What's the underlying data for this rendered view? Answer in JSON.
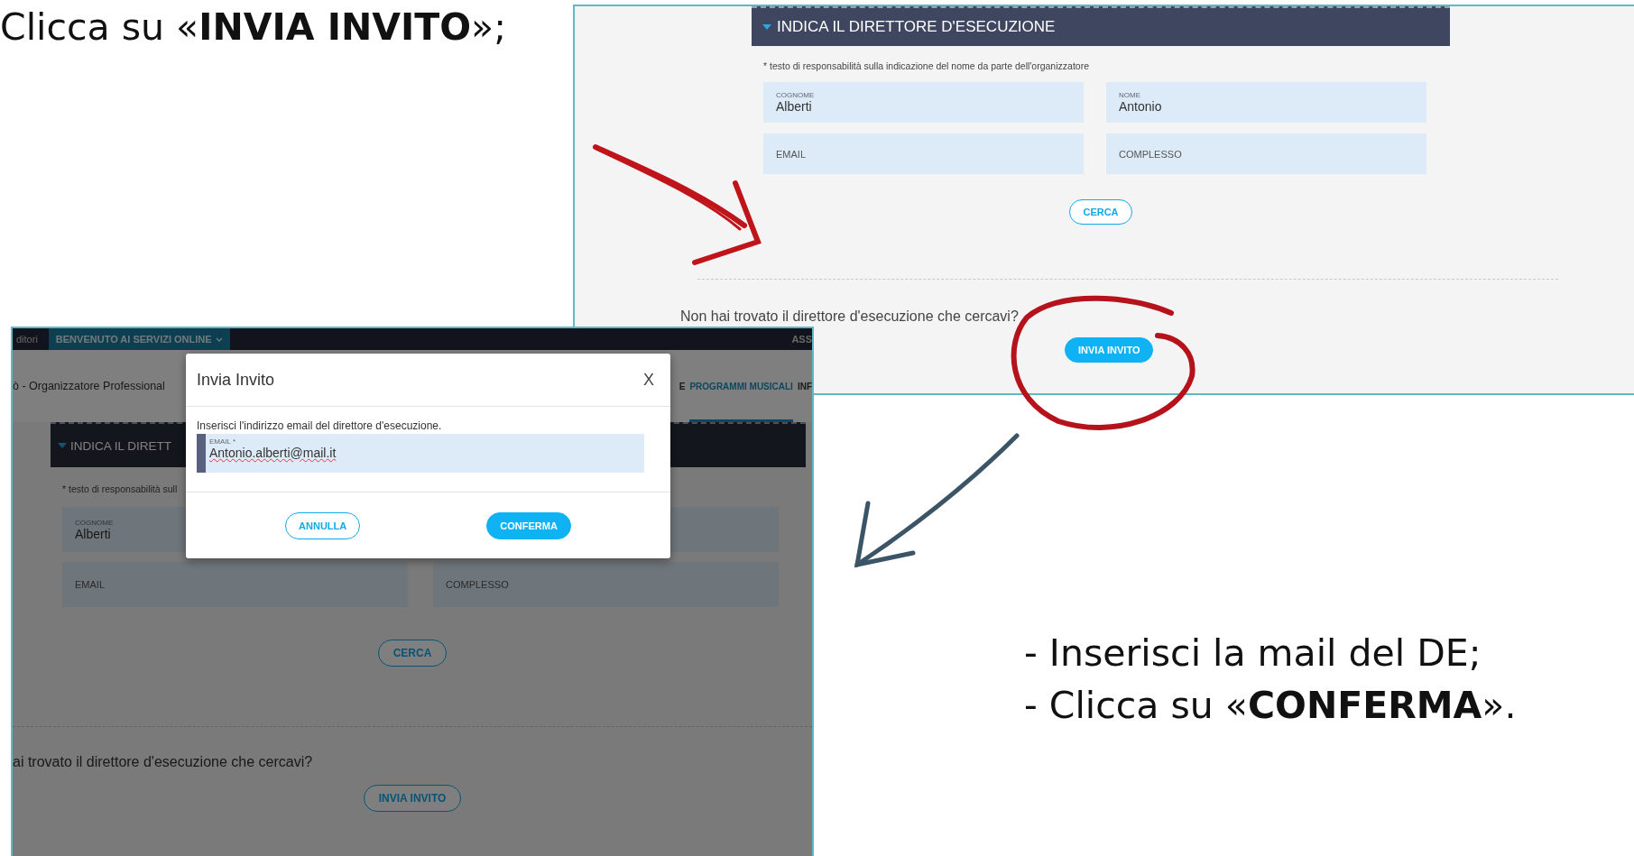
{
  "instruction_top": "Clicca su «**INVIA INVITO**»;",
  "search_screen": {
    "section_title": "INDICA IL DIRETTORE D'ESECUZIONE",
    "note": "* testo di responsabilità sulla indicazione del nome da parte dell'organizzatore",
    "fields": [
      {
        "label": "COGNOME",
        "value": "Alberti"
      },
      {
        "label": "NOME",
        "value": "Antonio"
      },
      {
        "placeholder": "EMAIL"
      },
      {
        "placeholder": "COMPLESSO"
      }
    ],
    "search_button": {
      "label": "CERCA",
      "kind": "outline"
    },
    "not_found_text": "Non hai trovato il direttore d'esecuzione che cercavi?",
    "invite_button": {
      "label": "INVIA INVITO",
      "kind": "filled"
    }
  },
  "dialog_screen": {
    "top_bar": [
      {
        "label": "ditori",
        "selected": false
      },
      {
        "label": "BENVENUTO AI SERVIZI ONLINE",
        "selected": true
      },
      {
        "label": "ASS",
        "selected": false
      }
    ],
    "page_title": "ò - Organizzatore Professional",
    "tabs": [
      {
        "label": "E",
        "selected": false
      },
      {
        "label": "PROGRAMMI MUSICALI",
        "selected": true
      },
      {
        "label": "INF",
        "selected": false
      }
    ],
    "section_title": "INDICA IL DIRETT",
    "note": "* testo di responsabilità sull",
    "fields": [
      {
        "kind": "text",
        "label": "COGNOME",
        "value": "Alberti"
      },
      {
        "kind": "blank"
      },
      {
        "kind": "text",
        "placeholder": "EMAIL"
      },
      {
        "kind": "text",
        "placeholder": "COMPLESSO"
      }
    ],
    "search_button": {
      "label": "CERCA",
      "kind": "outline"
    },
    "not_found_text": "ai trovato il direttore d'esecuzione che cercavi?",
    "invite_button": {
      "label": "INVIA INVITO",
      "kind": "outline"
    },
    "dialog": {
      "title": "Invia Invito",
      "close": "X",
      "prompt": "Inserisci l'indirizzo email del direttore d'esecuzione.",
      "field_label": "EMAIL *",
      "field_value": "Antonio.alberti@mail.it",
      "buttons": [
        {
          "label": "ANNULLA",
          "kind": "outline"
        },
        {
          "label": "CONFERMA",
          "kind": "filled"
        }
      ]
    }
  },
  "instructions_bottom": [
    "- Inserisci la mail del DE;",
    "- Clicca su «**CONFERMA**»."
  ]
}
